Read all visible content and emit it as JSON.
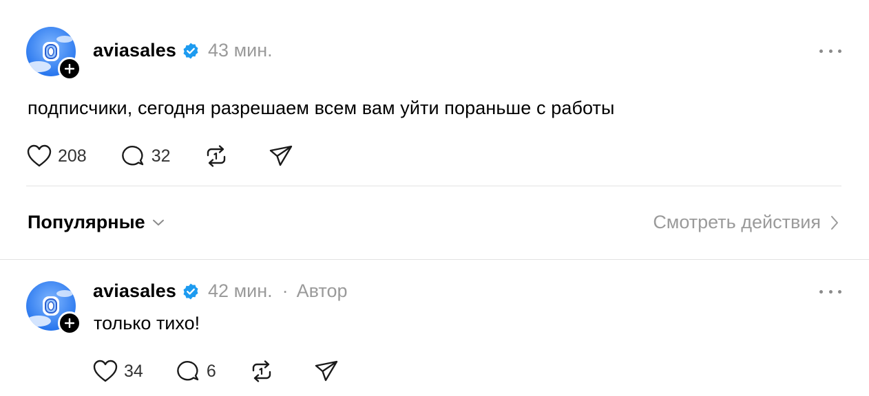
{
  "post": {
    "username": "aviasales",
    "timestamp": "43 мин.",
    "text": "подписчики, сегодня разрешаем всем вам уйти пораньше с работы",
    "likes": "208",
    "replies": "32"
  },
  "sort": {
    "label": "Популярные",
    "view_activity": "Смотреть действия"
  },
  "reply": {
    "username": "aviasales",
    "timestamp": "42 мин.",
    "separator": "·",
    "author_tag": "Автор",
    "text": "только тихо!",
    "likes": "34",
    "replies": "6"
  },
  "colors": {
    "verified": "#1d9bf0",
    "avatar_bg": "#1877f2",
    "muted_text": "#9a9a9a"
  },
  "icons": [
    "heart-icon",
    "comment-icon",
    "repost-icon",
    "share-icon",
    "verified-icon",
    "plus-icon",
    "more-icon",
    "chevron-down-icon",
    "chevron-right-icon"
  ]
}
